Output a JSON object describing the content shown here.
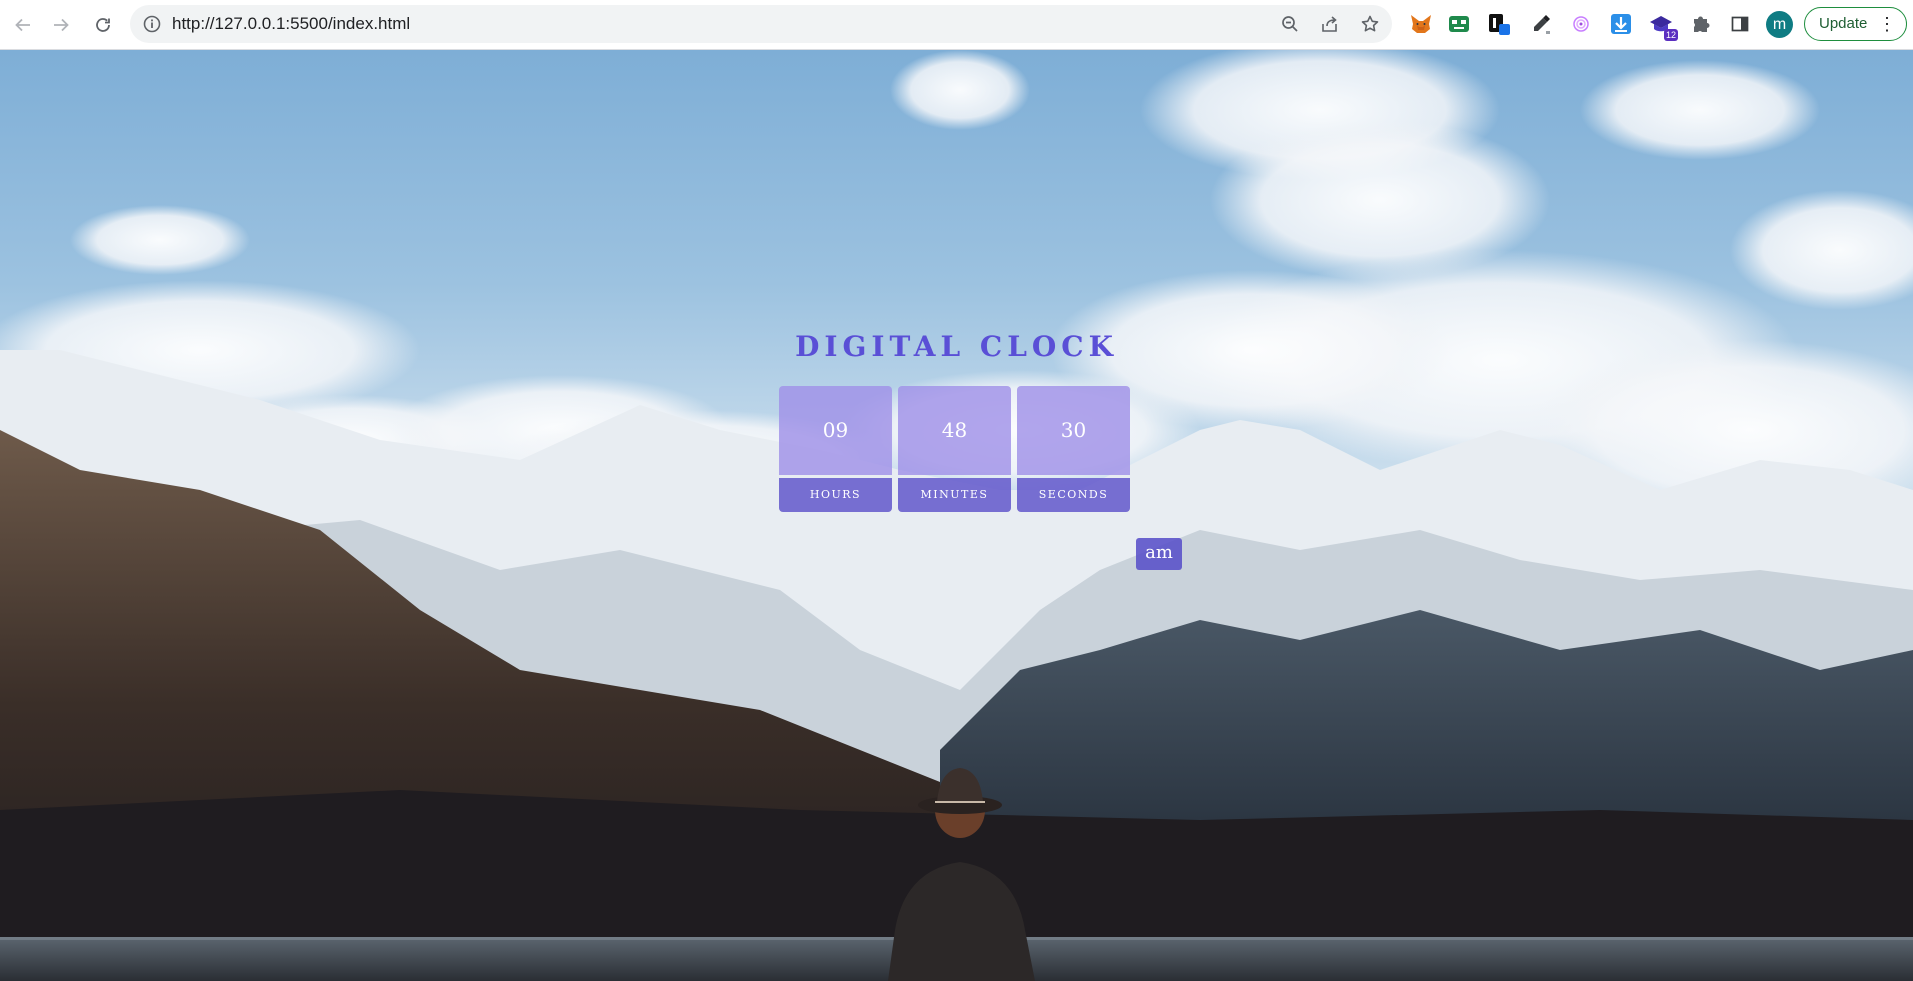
{
  "browser": {
    "url": "http://127.0.0.1:5500/index.html",
    "profile_initial": "m",
    "update_label": "Update",
    "extension_badge": "12",
    "icons": {
      "back": "arrow-left-icon",
      "forward": "arrow-right-icon",
      "reload": "reload-icon",
      "site_info": "info-icon",
      "zoom": "zoom-icon",
      "share": "share-icon",
      "bookmark": "star-icon",
      "extensions": [
        "fox-extension-icon",
        "robot-extension-icon",
        "tab-extension-icon",
        "eyedropper-extension-icon",
        "spiral-extension-icon",
        "download-extension-icon",
        "hat-extension-icon",
        "puzzle-icon",
        "side-panel-icon",
        "kebab-menu-icon"
      ]
    },
    "colors": {
      "update_border": "#1e8e3e",
      "avatar": "#0f7c83"
    }
  },
  "clock": {
    "title": "DIGITAL CLOCK",
    "hours": "09",
    "minutes": "48",
    "seconds": "30",
    "hours_label": "HOURS",
    "minutes_label": "MINUTES",
    "seconds_label": "SECONDS",
    "period": "am",
    "colors": {
      "title": "#5a4fd6",
      "value_box": "#a091e8",
      "label_box": "#695fcd",
      "period_box": "#5850c8"
    }
  },
  "background": {
    "description_icon": "mountain-lake-photo"
  }
}
